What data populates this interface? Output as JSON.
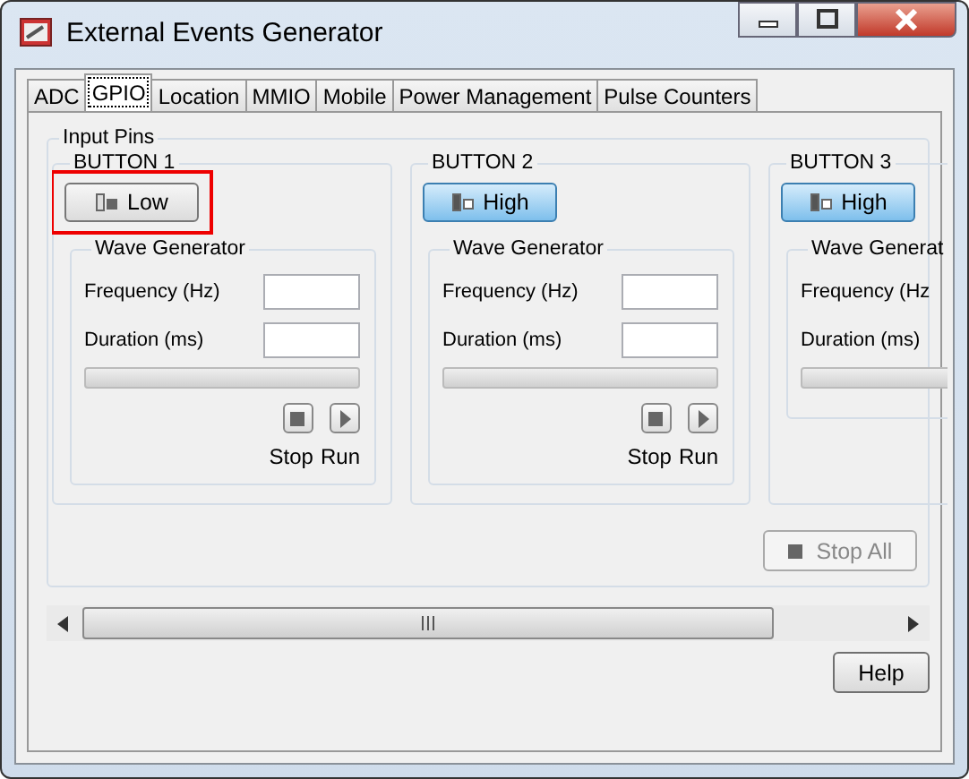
{
  "window": {
    "title": "External Events Generator"
  },
  "tabs": [
    {
      "label": "ADC",
      "selected": false
    },
    {
      "label": "GPIO",
      "selected": true
    },
    {
      "label": "Location",
      "selected": false
    },
    {
      "label": "MMIO",
      "selected": false
    },
    {
      "label": "Mobile",
      "selected": false
    },
    {
      "label": "Power Management",
      "selected": false
    },
    {
      "label": "Pulse Counters",
      "selected": false
    }
  ],
  "input_pins": {
    "title": "Input Pins",
    "pins": [
      {
        "kind": "full",
        "name": "BUTTON 1",
        "state_label": "Low",
        "high": false,
        "highlighted": true,
        "wave_title": "Wave Generator",
        "fields": [
          "Frequency (Hz)",
          "Duration (ms)"
        ],
        "level": 0,
        "controls": [
          {
            "kind": "stop",
            "label": "Stop"
          },
          {
            "kind": "run",
            "label": "Run"
          }
        ]
      },
      {
        "kind": "full",
        "name": "BUTTON 2",
        "state_label": "High",
        "high": true,
        "highlighted": false,
        "wave_title": "Wave Generator",
        "fields": [
          "Frequency (Hz)",
          "Duration (ms)"
        ],
        "level": 0,
        "controls": [
          {
            "kind": "stop",
            "label": "Stop"
          },
          {
            "kind": "run",
            "label": "Run"
          }
        ]
      },
      {
        "kind": "clipped",
        "name": "BUTTON 3",
        "state_label": "High",
        "high": true,
        "highlighted": false,
        "wave_title": "Wave Generat",
        "fields": [
          "Frequency (Hz",
          "Duration (ms)"
        ],
        "level": 0
      }
    ],
    "stop_all": {
      "label": "Stop All",
      "disabled": true
    }
  },
  "buttons": {
    "help": "Help"
  }
}
